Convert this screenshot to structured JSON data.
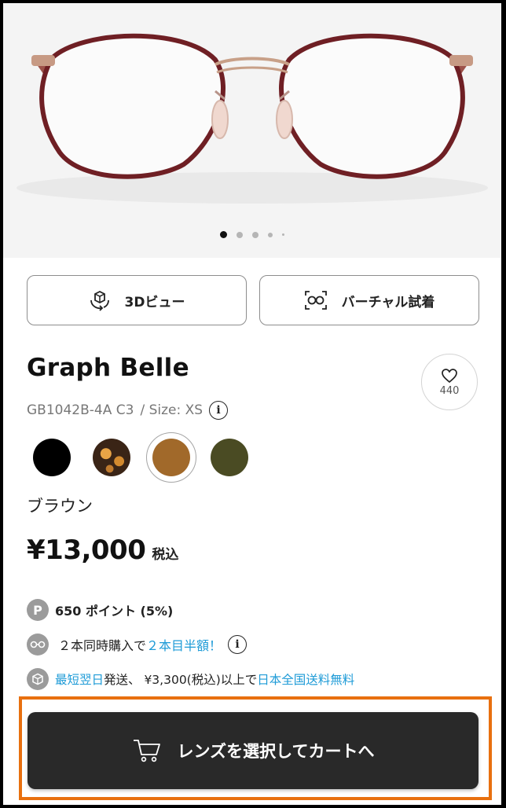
{
  "product": {
    "name": "Graph Belle",
    "model": "GB1042B-4A C3",
    "size_label": "/ Size: XS",
    "info_glyph": "i",
    "favorite_count": "440",
    "selected_color_name": "ブラウン",
    "price": "¥13,000",
    "tax_label": "税込",
    "colors": [
      "#000000",
      "#3a2416",
      "#a1692a",
      "#4a4b23"
    ],
    "selected_color_index": 2
  },
  "gallery": {
    "dot_count": 5,
    "active_dot": 0
  },
  "view_buttons": {
    "view3d_label": "3Dビュー",
    "tryon_label": "バーチャル試着"
  },
  "benefits": {
    "points_badge": "P",
    "points_amount": "650 ポイント (5%)",
    "pair_prefix": "２本同時購入で",
    "pair_link": "２本目半額！",
    "shipping_link1": "最短翌日",
    "shipping_mid": "発送、 ¥3,300(税込)以上で",
    "shipping_link2": "日本全国送料無料"
  },
  "cta": {
    "label": "レンズを選択してカートへ"
  },
  "colors": {
    "accent_blue": "#1e9bd7",
    "cta_bg": "#292929",
    "highlight": "#e8700f"
  }
}
